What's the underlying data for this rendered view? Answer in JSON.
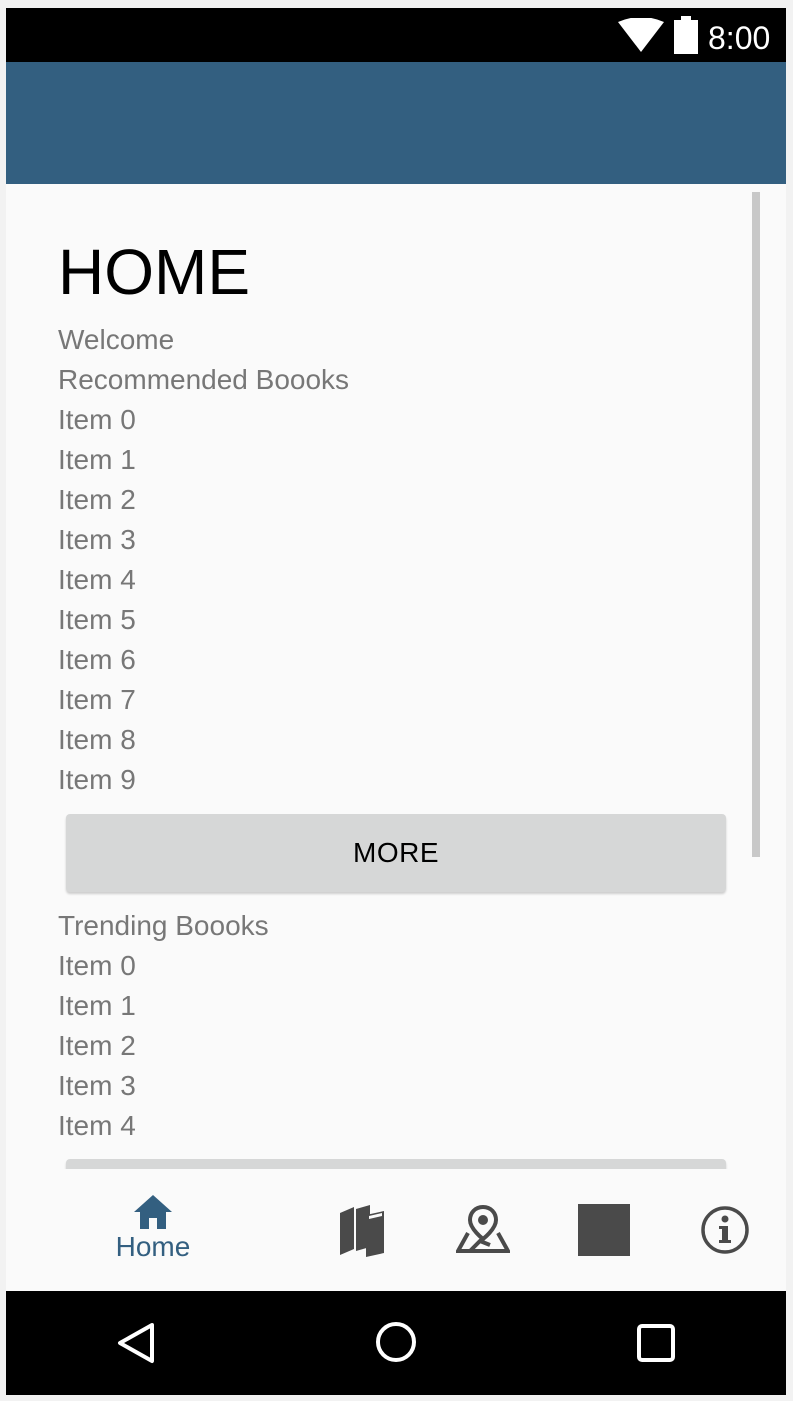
{
  "status_bar": {
    "time": "8:00",
    "icons": [
      "wifi-icon",
      "battery-icon"
    ]
  },
  "page": {
    "title": "HOME",
    "welcome": "Welcome"
  },
  "recommended": {
    "heading": "Recommended Boooks",
    "items": [
      "Item 0",
      "Item 1",
      "Item 2",
      "Item 3",
      "Item 4",
      "Item 5",
      "Item 6",
      "Item 7",
      "Item 8",
      "Item 9"
    ],
    "more_label": "MORE"
  },
  "trending": {
    "heading": "Trending Boooks",
    "items": [
      "Item 0",
      "Item 1",
      "Item 2",
      "Item 3",
      "Item 4"
    ]
  },
  "bottom_nav": {
    "home_label": "Home",
    "icons": [
      "home-icon",
      "books-icon",
      "map-pin-icon",
      "square-icon",
      "info-icon"
    ]
  },
  "system_nav": {
    "icons": [
      "back-icon",
      "home-circle-icon",
      "recents-icon"
    ]
  },
  "colors": {
    "app_bar": "#335f80",
    "accent": "#335f80",
    "text_secondary": "#777777",
    "button": "#d6d7d7"
  }
}
